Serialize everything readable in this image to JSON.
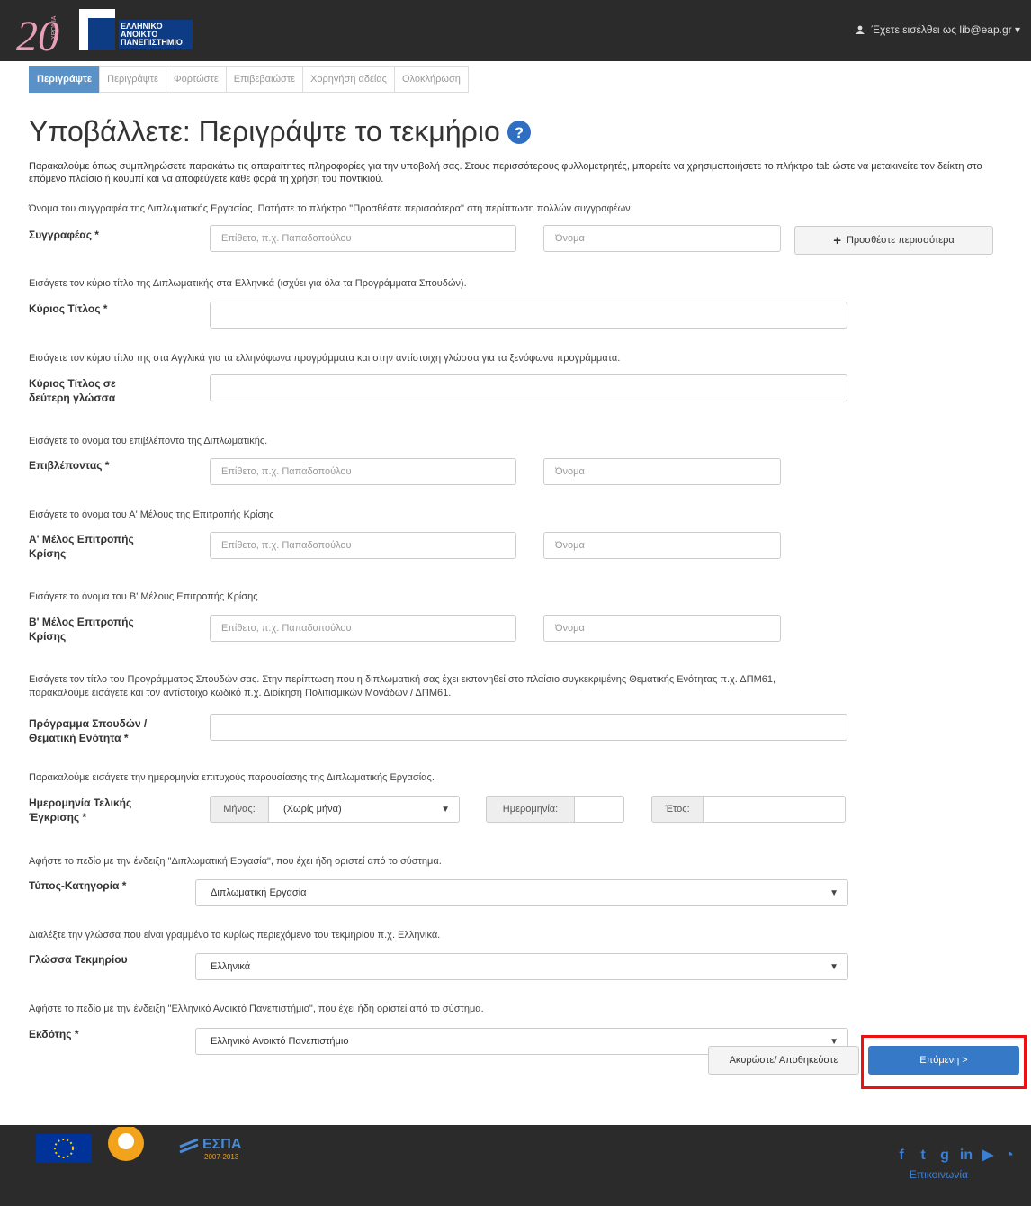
{
  "header": {
    "logo_text": "20 ΧΡΟΝΙΑ",
    "brand_lines": [
      "ΕΛΛΗΝΙΚΟ",
      "ΑΝΟΙΚΤΟ",
      "ΠΑΝΕΠΙΣΤΗΜΙΟ"
    ],
    "user_text": "Έχετε εισέλθει ως lib@eap.gr",
    "user_caret": "▾"
  },
  "steps": [
    "Περιγράψτε",
    "Περιγράψτε",
    "Φορτώστε",
    "Επιβεβαιώστε",
    "Χορηγήση αδείας",
    "Ολοκλήρωση"
  ],
  "page_title": "Υποβάλλετε: Περιγράψτε το τεκμήριο",
  "intro": "Παρακαλούμε όπως συμπληρώσετε παρακάτω τις απαραίτητες πληροφορίες για την υποβολή σας. Στους περισσότερους φυλλομετρητές, μπορείτε να χρησιμοποιήσετε το πλήκτρο tab ώστε να μετακινείτε τον δείκτη στο επόμενο πλαίσιο ή κουμπί και να αποφεύγετε κάθε φορά τη χρήση του ποντικιού.",
  "fields": {
    "author": {
      "hint": "Όνομα του συγγραφέα της Διπλωματικής Εργασίας. Πατήστε το πλήκτρο \"Προσθέστε περισσότερα\" στη περίπτωση πολλών συγγραφέων.",
      "label": "Συγγραφέας *",
      "last_placeholder": "Επίθετο, π.χ. Παπαδοπούλου",
      "first_placeholder": "Όνομα",
      "add_more": "Προσθέστε περισσότερα"
    },
    "title": {
      "hint": "Εισάγετε τον κύριο τίτλο της Διπλωματικής στα Ελληνικά (ισχύει για όλα τα Προγράμματα Σπουδών).",
      "label": "Κύριος Τίτλος *"
    },
    "title_alt": {
      "hint": "Εισάγετε τον κύριο τίτλο της στα Αγγλικά για τα ελληνόφωνα προγράμματα και στην αντίστοιχη γλώσσα για τα ξενόφωνα προγράμματα.",
      "label_1": "Κύριος Τίτλος σε",
      "label_2": "δεύτερη γλώσσα"
    },
    "supervisor": {
      "hint": "Εισάγετε το όνομα του επιβλέποντα της Διπλωματικής.",
      "label": "Επιβλέποντας *",
      "last_placeholder": "Επίθετο, π.χ. Παπαδοπούλου",
      "first_placeholder": "Όνομα"
    },
    "member_a": {
      "hint": "Εισάγετε το όνομα του Α' Μέλους της Επιτροπής Κρίσης",
      "label_1": "Α' Μέλος Επιτροπής",
      "label_2": "Κρίσης",
      "last_placeholder": "Επίθετο, π.χ. Παπαδοπούλου",
      "first_placeholder": "Όνομα"
    },
    "member_b": {
      "hint": "Εισάγετε το όνομα του Β' Μέλους Επιτροπής Κρίσης",
      "label_1": "Β' Μέλος Επιτροπής",
      "label_2": "Κρίσης",
      "last_placeholder": "Επίθετο, π.χ. Παπαδοπούλου",
      "first_placeholder": "Όνομα"
    },
    "program": {
      "hint_1": "Εισάγετε τον τίτλο του Προγράμματος Σπουδών σας. Στην περίπτωση που η διπλωματική σας έχει εκπονηθεί στο πλαίσιο συγκεκριμένης Θεματικής Ενότητας π.χ. ΔΠΜ61,",
      "hint_2": "παρακαλούμε εισάγετε και τον αντίστοιχο κωδικό π.χ. Διοίκηση Πολιτισμικών Μονάδων / ΔΠΜ61.",
      "label_1": "Πρόγραμμα Σπουδών /",
      "label_2": "Θεματική Ενότητα *"
    },
    "date": {
      "hint": "Παρακαλούμε εισάγετε την ημερομηνία επιτυχούς παρουσίασης της Διπλωματικής Εργασίας.",
      "label_1": "Ημερομηνία Τελικής",
      "label_2": "Έγκρισης *",
      "month_addon": "Μήνας:",
      "month_value": "(Χωρίς μήνα)",
      "day_addon": "Ημερομηνία:",
      "year_addon": "Έτος:"
    },
    "type": {
      "hint": "Αφήστε το πεδίο με την ένδειξη \"Διπλωματική Εργασία\", που έχει ήδη οριστεί από το σύστημα.",
      "label": "Τύπος-Κατηγορία *",
      "value": "Διπλωματική Εργασία"
    },
    "language": {
      "hint": "Διαλέξτε την γλώσσα που είναι γραμμένο το κυρίως περιεχόμενο του τεκμηρίου π.χ. Ελληνικά.",
      "label": "Γλώσσα Τεκμηρίου",
      "value": "Ελληνικά"
    },
    "publisher": {
      "hint": "Αφήστε το πεδίο με την ένδειξη \"Ελληνικό Ανοικτό Πανεπιστήμιο\", που έχει ήδη οριστεί από το σύστημα.",
      "label": "Εκδότης *",
      "value": "Ελληνικό Ανοικτό Πανεπιστήμιο"
    }
  },
  "actions": {
    "cancel": "Ακυρώστε/ Αποθηκεύστε",
    "next": "Επόμενη >"
  },
  "footer": {
    "espa_label": "ΕΣΠΑ",
    "espa_years": "2007-2013",
    "contact": "Επικοινωνία"
  },
  "colors": {
    "primary": "#3579c7",
    "step_active": "#5a92c7",
    "highlight": "#ee1111"
  }
}
